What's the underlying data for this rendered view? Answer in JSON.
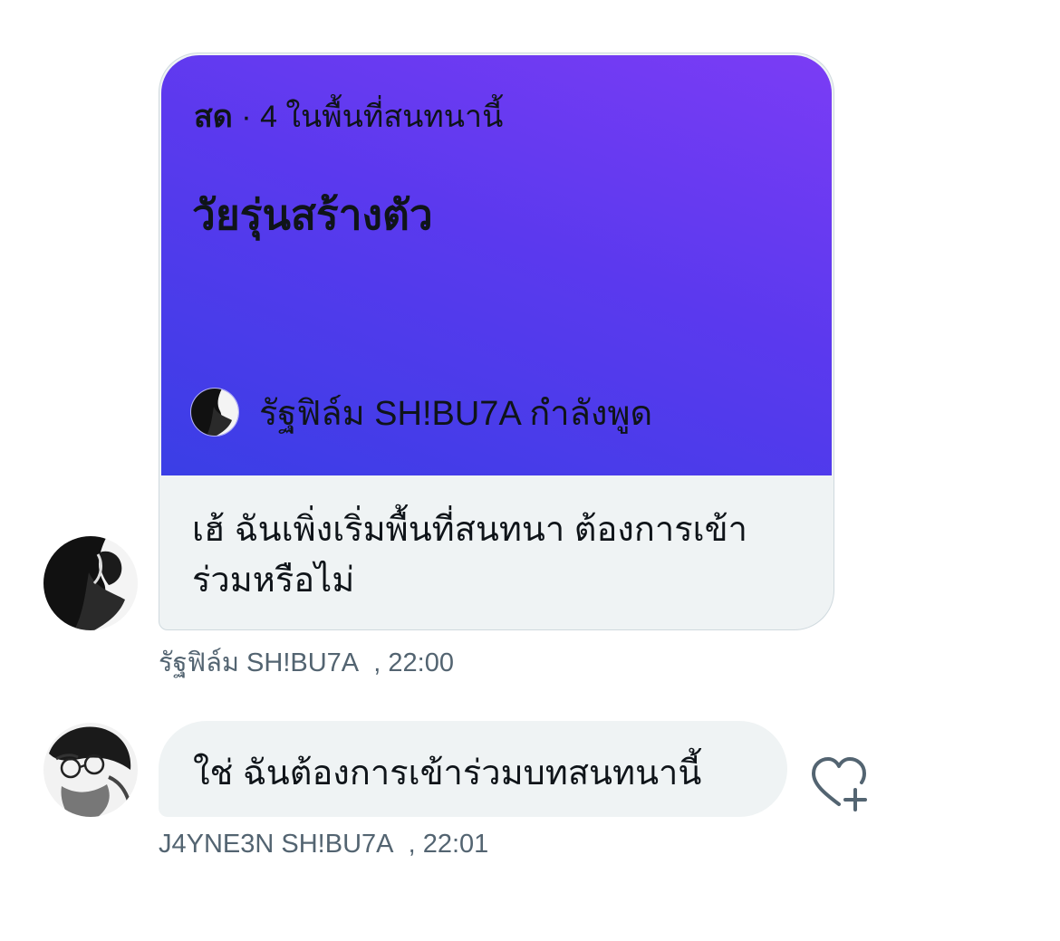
{
  "space_card": {
    "live_label": "สด",
    "separator": " · ",
    "listener_count": "4",
    "listener_text": " ในพื้นที่สนทนานี้",
    "title": "วัยรุ่นสร้างตัว",
    "host_name": "รัฐฟิล์ม SH!BU7A",
    "host_status": "กำลังพูด",
    "message": "เฮ้ ฉันเพิ่งเริ่มพื้นที่สนทนา ต้องการเข้าร่วมหรือไม่",
    "gradient_colors": [
      "#7b3cf5",
      "#3a3ee6"
    ]
  },
  "message_1": {
    "sender": "รัฐฟิล์ม SH!BU7A",
    "time": ", 22:00"
  },
  "message_2": {
    "text": "ใช่ ฉันต้องการเข้าร่วมบทสนทนานี้",
    "sender": "J4YNE3N SH!BU7A",
    "time": ", 22:01",
    "reaction_icon": "heart-plus-icon"
  }
}
